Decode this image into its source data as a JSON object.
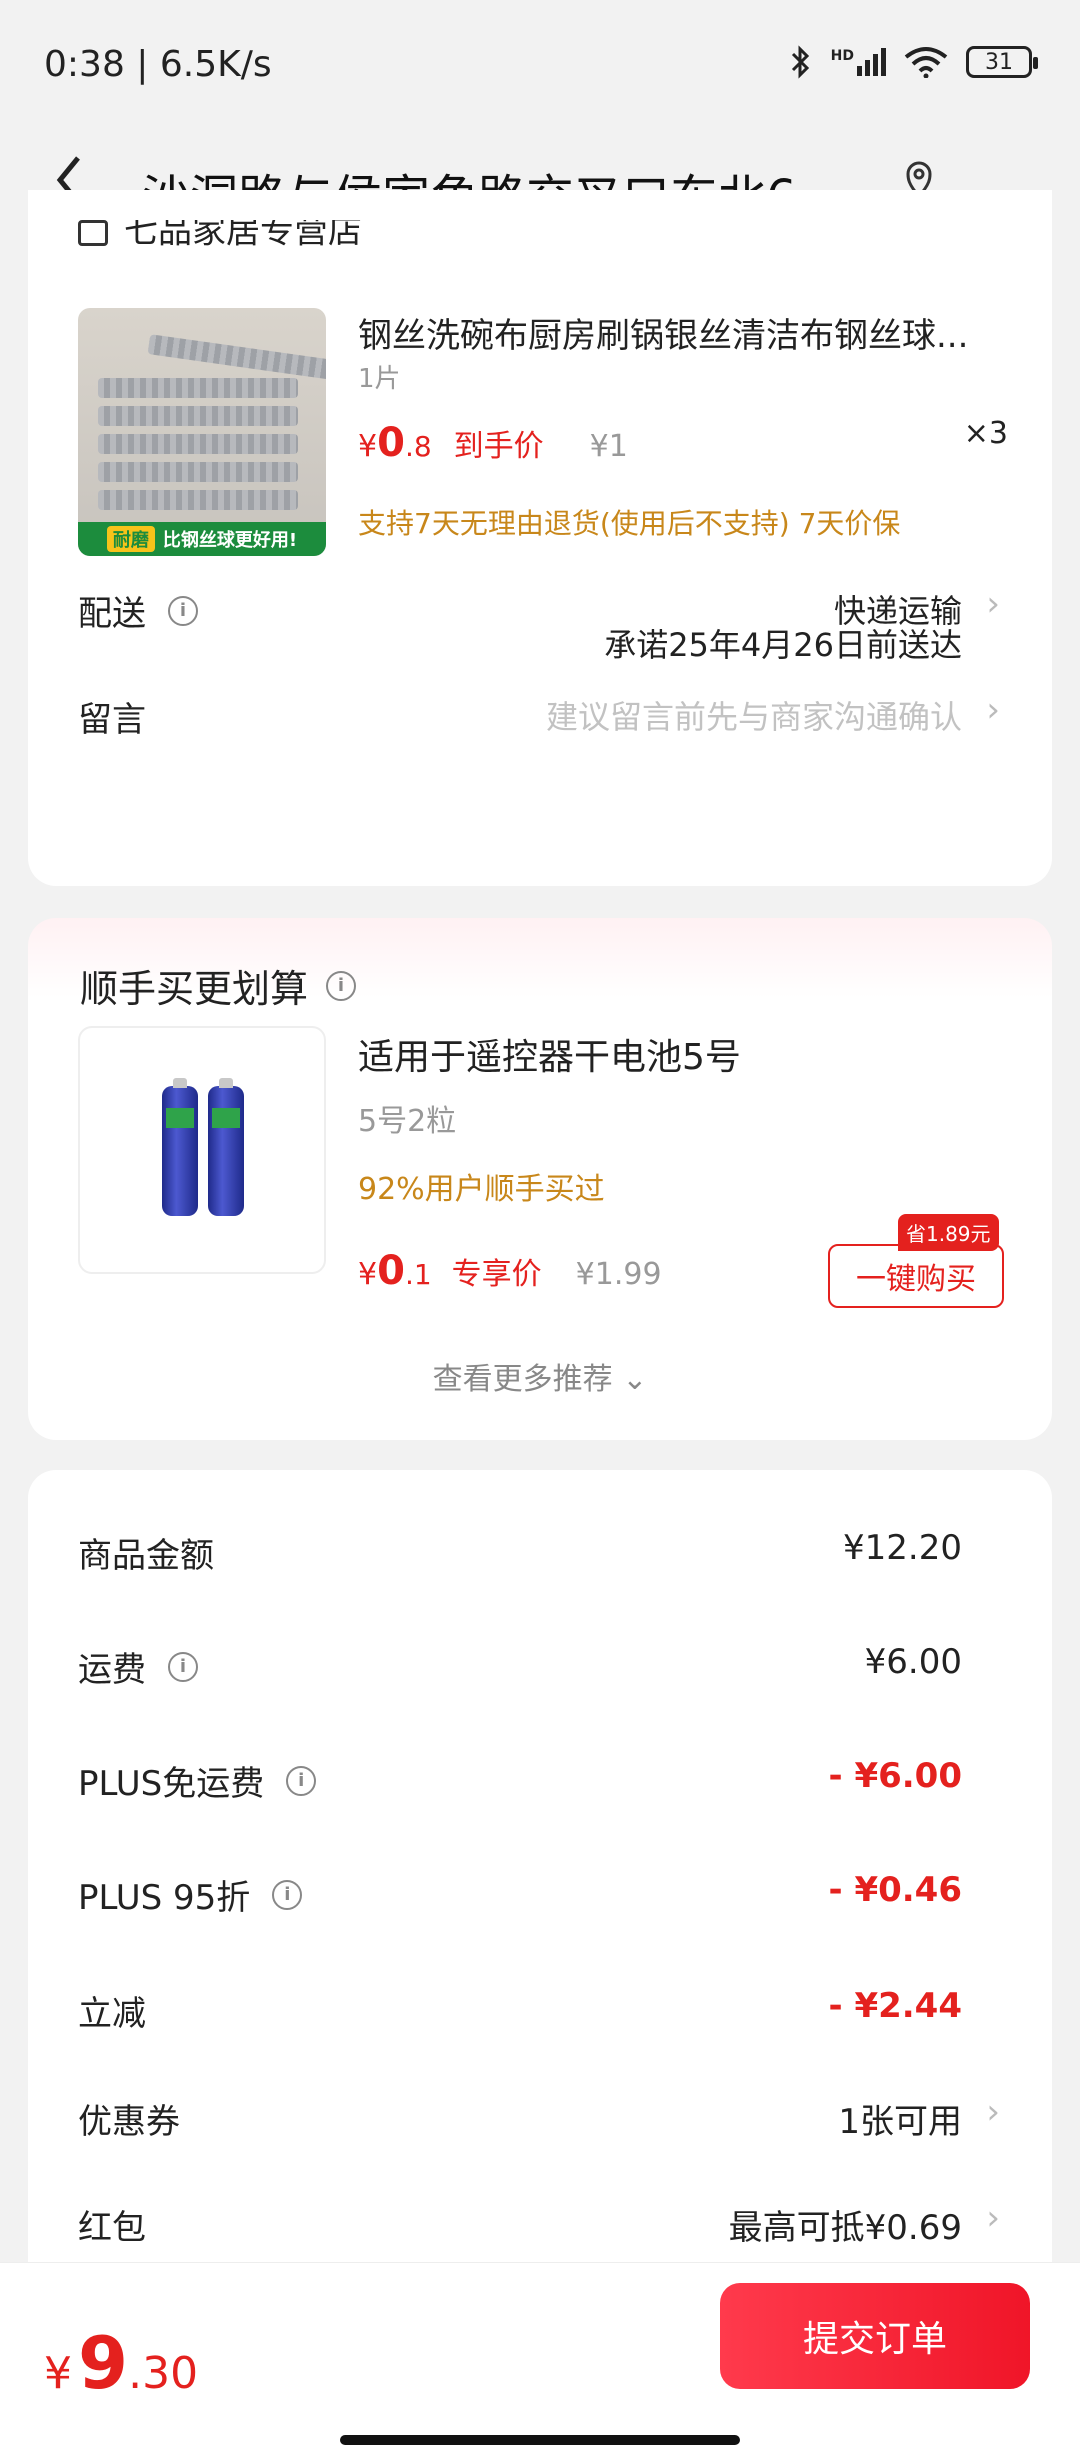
{
  "status": {
    "time": "0:38 | 6.5K/s",
    "battery": "31",
    "icons": [
      "bluetooth-icon",
      "signal-icon",
      "wifi-icon",
      "battery-icon"
    ]
  },
  "nav": {
    "title": "沙洞路与侯家角路交叉口东北6...",
    "icons": [
      "back-icon",
      "location-icon"
    ]
  },
  "order": {
    "store_name": "七品家居专营店",
    "product": {
      "title": "钢丝洗碗布厨房刷锅银丝清洁布钢丝球...",
      "spec": "1片",
      "price_symbol": "¥",
      "price_int": "0",
      "price_dec": ".8",
      "price_tag": "到手价",
      "original_price": "¥1",
      "quantity": "×3",
      "guarantee": "支持7天无理由退货(使用后不支持) 7天价保",
      "image_banner_left": "耐磨",
      "image_banner_right": "比钢丝球更好用!"
    },
    "delivery": {
      "label": "配送",
      "method": "快递运输",
      "promise": "承诺25年4月26日前送达"
    },
    "message": {
      "label": "留言",
      "placeholder": "建议留言前先与商家沟通确认"
    }
  },
  "addon": {
    "title": "顺手买更划算",
    "product": {
      "title": "适用于遥控器干电池5号",
      "spec": "5号2粒",
      "bought": "92%用户顺手买过",
      "price_symbol": "¥",
      "price_int": "0",
      "price_dec": ".1",
      "price_tag": "专享价",
      "original_price": "¥1.99",
      "save_badge": "省1.89元",
      "buy_button": "一键购买"
    },
    "more": "查看更多推荐 ⌄"
  },
  "summary": {
    "rows": [
      {
        "label": "商品金额",
        "value": "¥12.20"
      },
      {
        "label": "运费",
        "value": "¥6.00"
      },
      {
        "label": "PLUS免运费",
        "value": "- ¥6.00"
      },
      {
        "label": "PLUS 95折",
        "value": "- ¥0.46"
      },
      {
        "label": "立减",
        "value": "- ¥2.44"
      },
      {
        "label": "优惠券",
        "value": "1张可用"
      },
      {
        "label": "红包",
        "value": "最高可抵¥0.69"
      }
    ]
  },
  "footer": {
    "total_symbol": "¥",
    "total_int": "9",
    "total_dec": ".30",
    "submit": "提交订单"
  },
  "colors": {
    "accent_red": "#e4211e",
    "gold": "#c8871a",
    "submit_gradient_start": "#ff3a4c",
    "submit_gradient_end": "#f01528"
  }
}
